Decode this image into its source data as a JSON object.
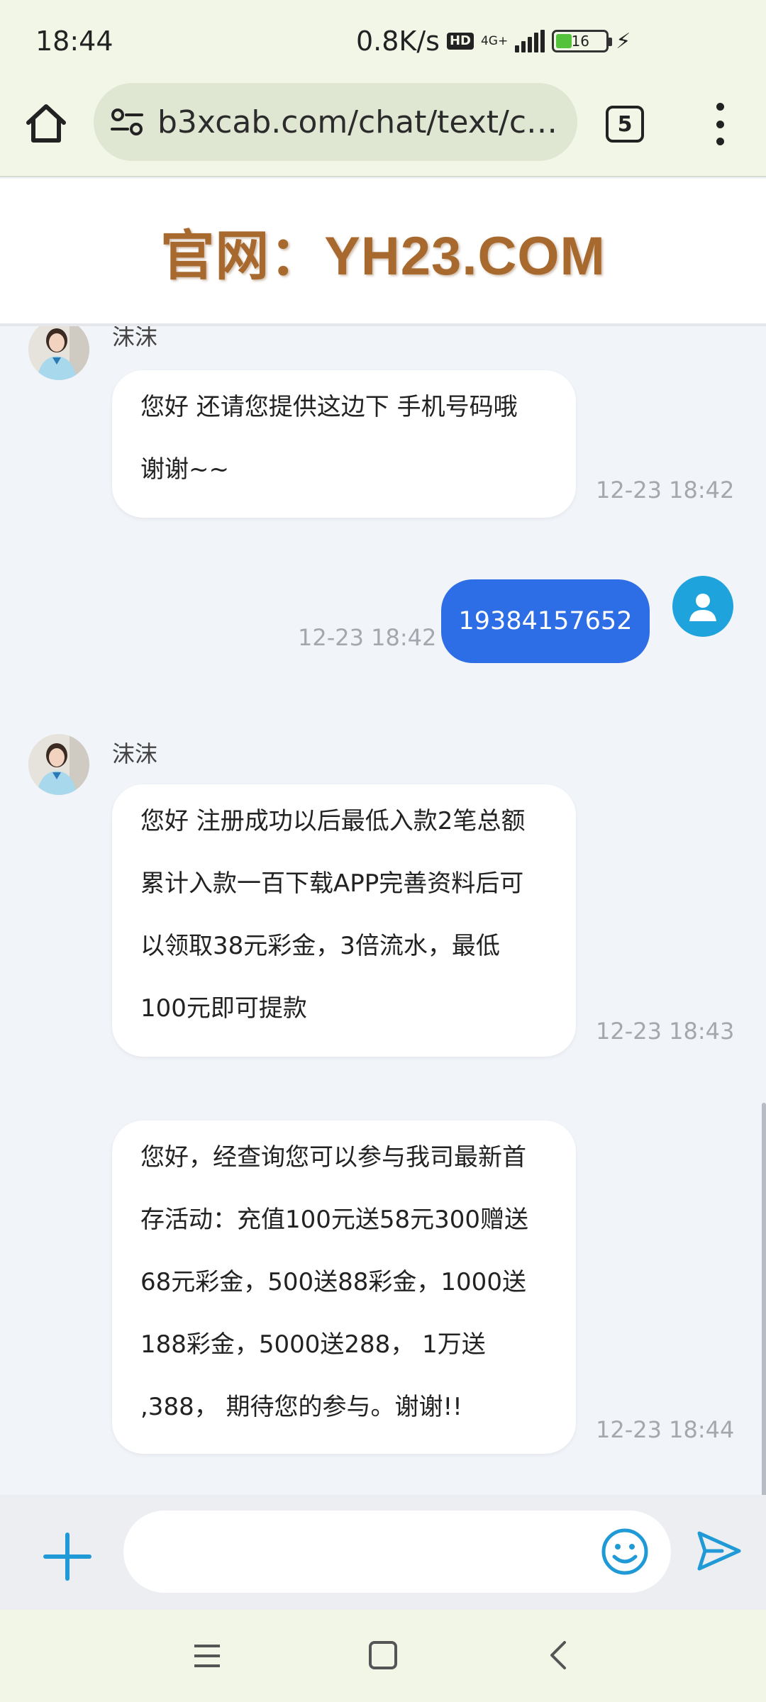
{
  "status_bar": {
    "time": "18:44",
    "net_speed": "0.8K/s",
    "hd_label": "HD",
    "network_type": "4G+",
    "battery_level": "16"
  },
  "browser": {
    "url": "b3xcab.com/chat/text/chat_",
    "tab_count": "5"
  },
  "site": {
    "banner": "官网：YH23.COM"
  },
  "messages": {
    "m1": {
      "sender": "沫沫",
      "text_line1": "您好 还请您提供这边下 手机号码哦",
      "text_line2": "谢谢~~",
      "time": "12-23 18:42"
    },
    "m2": {
      "text": "19384157652",
      "time": "12-23 18:42"
    },
    "m3": {
      "sender": "沫沫",
      "lines": [
        "您好  注册成功以后最低入款2笔总额",
        "累计入款一百下载APP完善资料后可",
        "以领取38元彩金，3倍流水，最低",
        "100元即可提款"
      ],
      "time": "12-23 18:43"
    },
    "m4": {
      "lines": [
        "您好，经查询您可以参与我司最新首",
        "存活动：充值100元送58元300赠送",
        "68元彩金，500送88彩金，1000送",
        "188彩金，5000送288，  1万送",
        ",388，  期待您的参与。谢谢!!"
      ],
      "time": "12-23 18:44"
    }
  },
  "input": {
    "placeholder": ""
  },
  "colors": {
    "accent": "#2d6ee6",
    "icon_blue": "#1f9ad6",
    "browser_bg": "#f2f6e7",
    "banner": "#a8692e"
  }
}
